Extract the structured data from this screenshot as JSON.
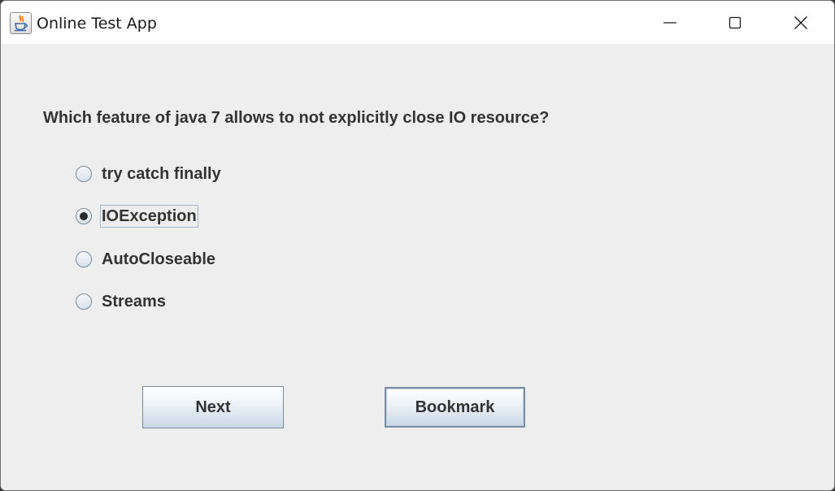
{
  "window": {
    "title": "Online Test App",
    "app_icon": "java-cup-icon"
  },
  "title_controls": {
    "minimize_icon": "minimize-icon",
    "maximize_icon": "maximize-icon",
    "close_icon": "close-icon"
  },
  "quiz": {
    "question": "Which feature of java 7 allows to not explicitly close IO resource?",
    "options": [
      {
        "label": "try catch finally",
        "selected": false
      },
      {
        "label": "IOException",
        "selected": true
      },
      {
        "label": "AutoCloseable",
        "selected": false
      },
      {
        "label": "Streams",
        "selected": false
      }
    ],
    "next_label": "Next",
    "bookmark_label": "Bookmark"
  },
  "colors": {
    "window_bg": "#eeeeee",
    "titlebar_bg": "#ffffff",
    "text": "#333333",
    "button_gradient_bottom": "#c9d8e7"
  }
}
